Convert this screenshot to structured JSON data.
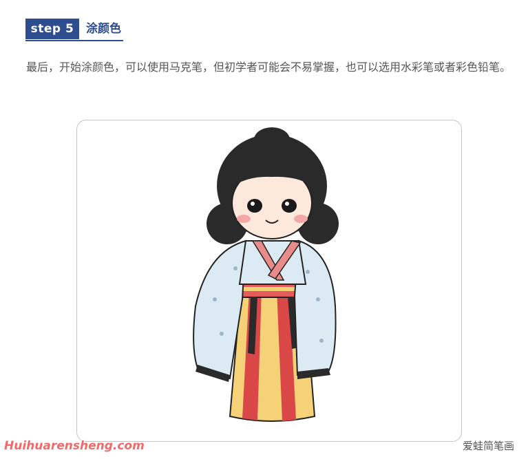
{
  "step": {
    "badge": "step 5",
    "title": "涂颜色"
  },
  "paragraph": "最后，开始涂颜色，可以使用马克笔，但初学者可能会不易掌握，也可以选用水彩笔或者彩色铅笔。",
  "watermark": {
    "site": "Huihuarensheng.com",
    "brand": "爱蛙简笔画"
  },
  "colors": {
    "accent": "#2e4d8e",
    "watermark": "#f06a6a",
    "sleeve": "#dbeaf3",
    "skirt_red": "#d94747",
    "skirt_yellow": "#f5d277",
    "hair": "#2a2a2a"
  }
}
